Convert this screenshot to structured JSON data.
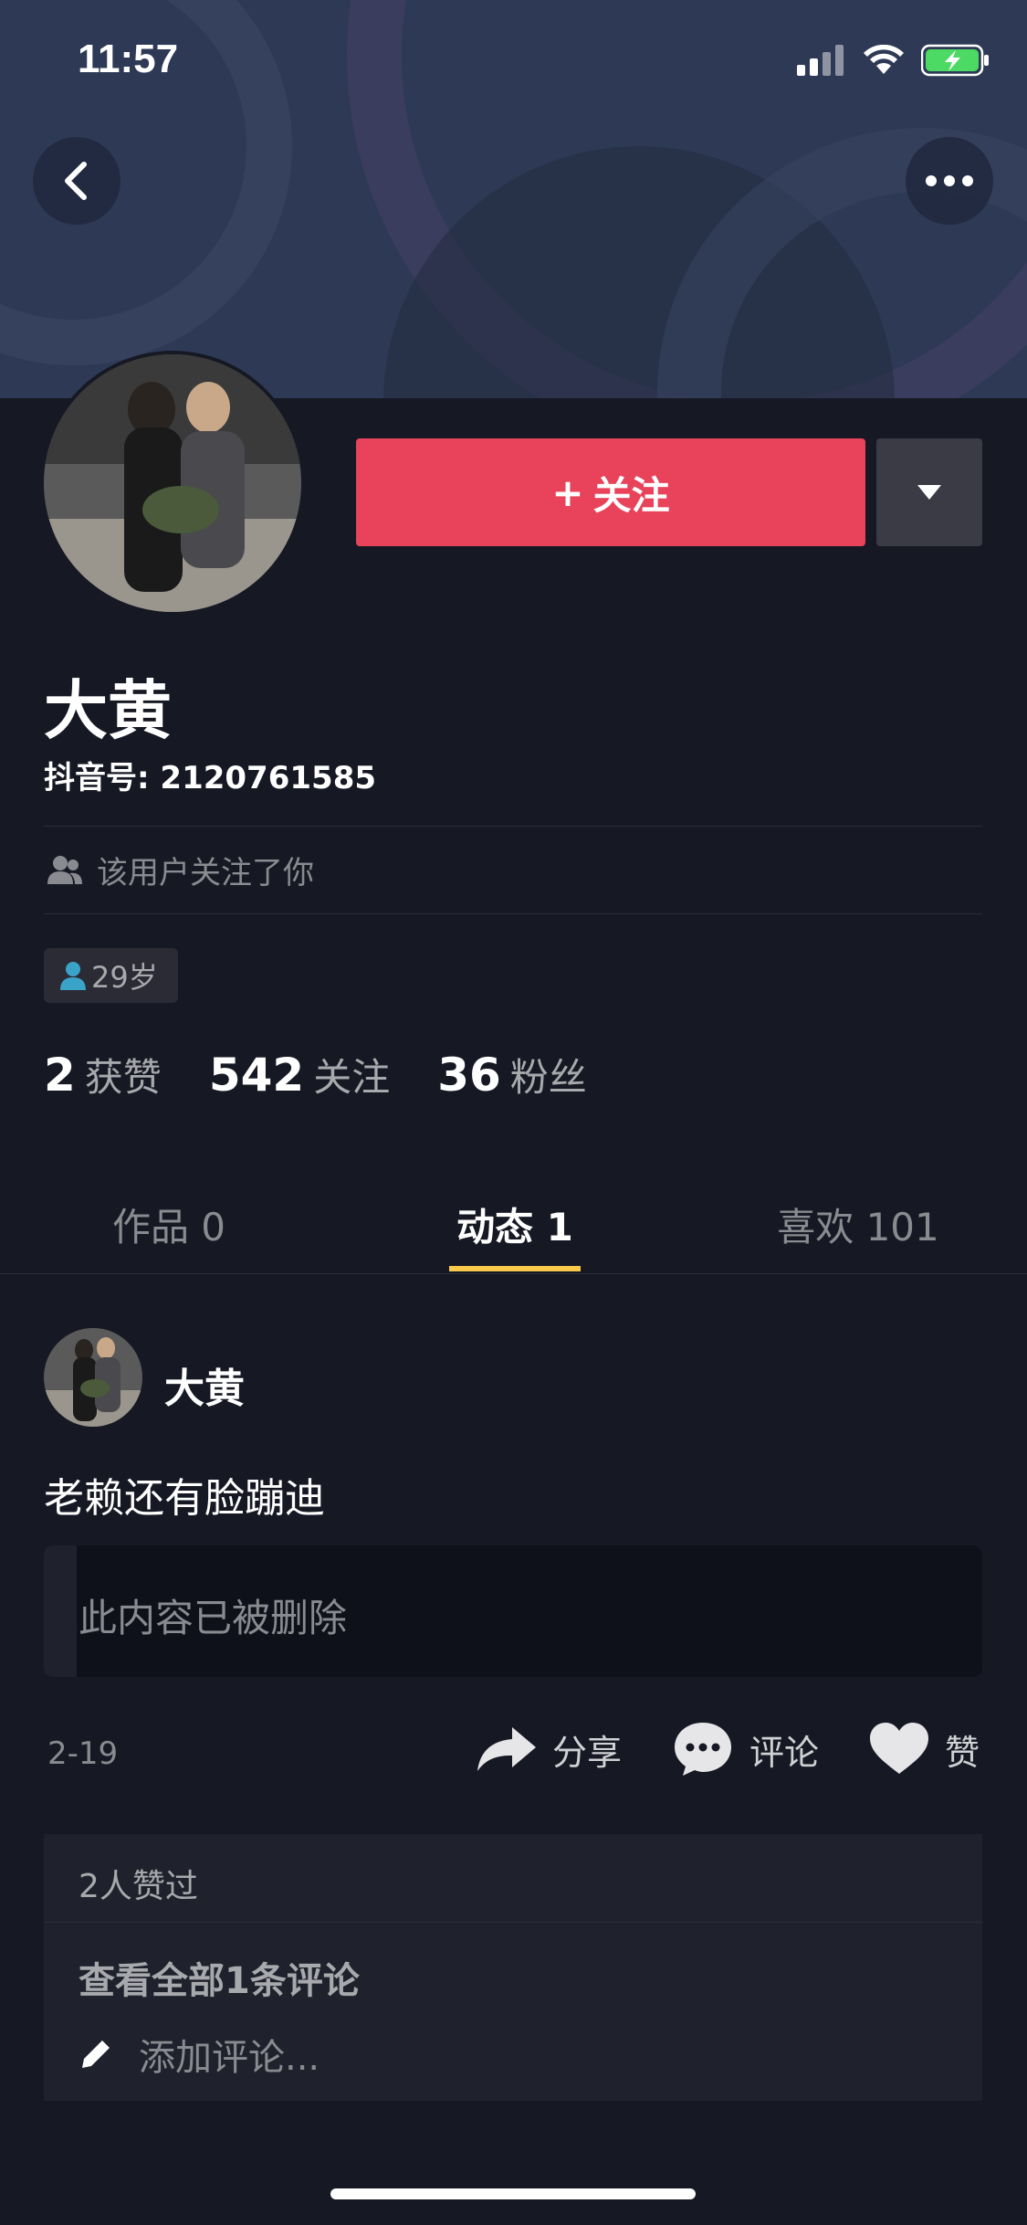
{
  "status_bar": {
    "time": "11:57"
  },
  "header": {
    "back_icon": "chevron-left-icon",
    "more_icon": "more-horizontal-icon"
  },
  "profile": {
    "follow_label": "关注",
    "follow_prefix": "+",
    "name": "大黄",
    "douyin_id": "抖音号: 2120761585",
    "follows_you": "该用户关注了你",
    "age": "29岁"
  },
  "stats": [
    {
      "num": "2",
      "label": "获赞"
    },
    {
      "num": "542",
      "label": "关注"
    },
    {
      "num": "36",
      "label": "粉丝"
    }
  ],
  "tabs": [
    {
      "label": "作品 0"
    },
    {
      "label": "动态 1"
    },
    {
      "label": "喜欢 101"
    }
  ],
  "post": {
    "author": "大黄",
    "text": "老赖还有脸蹦迪",
    "deleted_notice": "此内容已被删除",
    "date": "2-19",
    "share_label": "分享",
    "comment_label": "评论",
    "like_label": "赞",
    "likes_text": "2人赞过",
    "view_comments": "查看全部1条评论",
    "add_comment_placeholder": "添加评论..."
  },
  "colors": {
    "background": "#161823",
    "follow_button": "#e8435a",
    "tab_indicator": "#f8c94a",
    "banner": "#2e3a55"
  }
}
